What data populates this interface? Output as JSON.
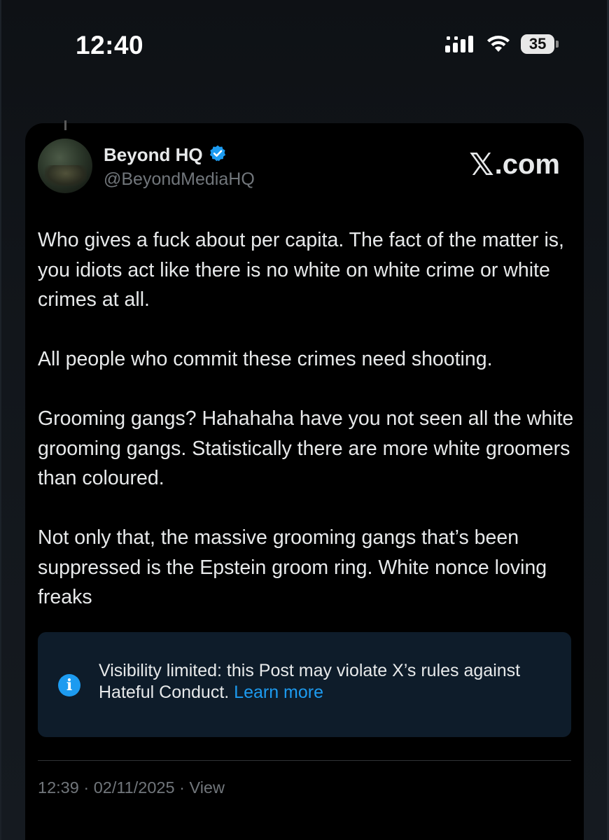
{
  "status_bar": {
    "time": "12:40",
    "battery": "35",
    "icons": [
      "signal-icon",
      "wifi-icon",
      "battery-icon"
    ]
  },
  "post": {
    "display_name": "Beyond HQ",
    "handle": "@BeyondMediaHQ",
    "verified": true,
    "brand": "X.com",
    "brand_x": "𝕏",
    "brand_rest": ".com",
    "paragraphs": [
      "Who gives a fuck about per capita. The fact of the matter is, you idiots act like there is no white on white crime or white crimes at all.",
      "All people who commit these crimes need shooting.",
      "Grooming gangs? Hahahaha have you not seen all the white grooming gangs. Statistically there are more white groomers than coloured.",
      "Not only that, the massive grooming gangs that’s been suppressed is the Epstein groom ring. White nonce loving freaks"
    ],
    "notice": {
      "text": "Visibility limited: this Post may violate X’s rules against Hateful Conduct.",
      "link": "Learn more",
      "icon": "info-icon"
    },
    "timestamp": "12:39 · 02/11/2025 · View"
  },
  "colors": {
    "background": "#000000",
    "text": "#e7e9ea",
    "muted": "#71767b",
    "accent": "#1d9bf0",
    "notice_bg": "#0e1c2a"
  }
}
